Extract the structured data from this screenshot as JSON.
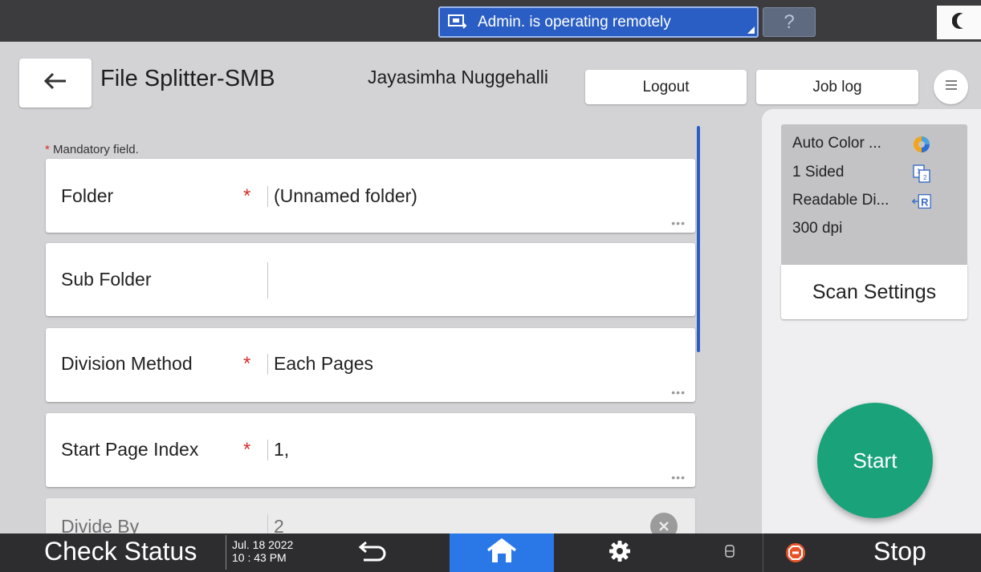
{
  "topbar": {
    "remote_status": "Admin. is operating remotely",
    "help_label": "?",
    "accent_color": "#2a5ec4"
  },
  "header": {
    "app_title": "File Splitter-SMB",
    "user_name": "Jayasimha Nuggehalli",
    "logout_label": "Logout",
    "joblog_label": "Job log"
  },
  "form": {
    "mandatory_note": "Mandatory field.",
    "required_marker": "*",
    "fields": [
      {
        "label": "Folder",
        "value": "(Unnamed folder)",
        "required": true
      },
      {
        "label": "Sub Folder",
        "value": "",
        "required": false
      },
      {
        "label": "Division Method",
        "value": "Each Pages",
        "required": true
      },
      {
        "label": "Start Page Index",
        "value": "1,",
        "required": true
      },
      {
        "label": "Divide By",
        "value": "2",
        "required": false
      }
    ]
  },
  "scan": {
    "color_mode": "Auto Color ...",
    "sides": "1 Sided",
    "orientation": "Readable Di...",
    "resolution": "300 dpi",
    "settings_label": "Scan Settings",
    "start_label": "Start",
    "start_color": "#1aa37a"
  },
  "bottombar": {
    "check_status_label": "Check Status",
    "date": "Jul. 18 2022",
    "time": "10 : 43 PM",
    "stop_label": "Stop"
  }
}
